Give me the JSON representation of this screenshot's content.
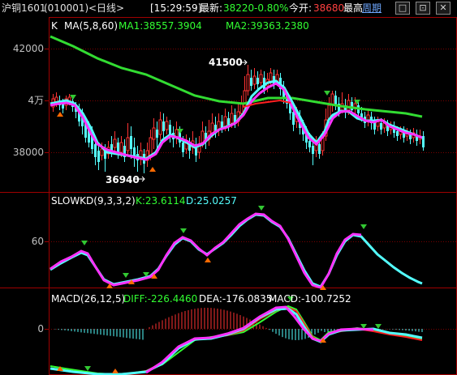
{
  "header": {
    "symbol": "沪铜1601",
    "code": "(010001)",
    "period": "<日线>",
    "time": "[15:29:59]",
    "latest_label": "最新:",
    "latest_value": "38220",
    "change_pct": "-0.80%",
    "open_label": "今开:",
    "open_value": "38680",
    "high_label": "最高",
    "cycle_link": "周期",
    "window_buttons": [
      "□",
      "⊡",
      "✕"
    ]
  },
  "main_panel": {
    "indicator": "K",
    "params": "MA(5,8,60)",
    "ma1": "MA1:38557.3904",
    "ma2": "MA2:39363.2380",
    "y_ticks": [
      "42000",
      "4万",
      "38000"
    ],
    "high_annotation": "41500",
    "low_annotation": "36940"
  },
  "kd_panel": {
    "title": "SLOWKD(9,3,3,2)",
    "k": "K:23.6114",
    "d": "D:25.0257",
    "y_ticks": [
      "60"
    ]
  },
  "macd_panel": {
    "title": "MACD(26,12,5)",
    "diff": "DIFF:-226.4460",
    "dea": "DEA:-176.0835",
    "macd": "MACD:-100.7252",
    "y_ticks": [
      "0"
    ]
  },
  "colors": {
    "up": "#ff3232",
    "down": "#54ffff",
    "ma_long": "#32dc32",
    "grid": "#8b0000",
    "label_green": "#32ff32",
    "label_white": "#ffffff",
    "magenta": "#ff32ff"
  }
}
